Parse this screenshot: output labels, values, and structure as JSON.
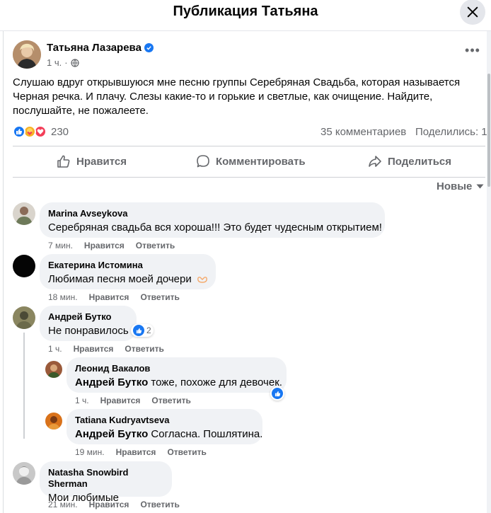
{
  "dialog": {
    "title": "Публикация Татьяна"
  },
  "post": {
    "author": "Татьяна Лазарева",
    "time": "1 ч.",
    "privacy_icon": "globe-icon",
    "text": "Слушаю вдруг открывшуюся мне песню группы Серебряная Свадьба, которая называется Черная речка. И плачу. Слезы какие-то и горькие и светлые, как очищение. Найдите, послушайте, не пожалеете.",
    "reactions_count": "230",
    "reaction_icons": [
      "like-icon",
      "care-icon",
      "love-icon"
    ],
    "comments_count": "35 комментариев",
    "shares_count": "Поделились: 1"
  },
  "actions": {
    "like": "Нравится",
    "comment": "Комментировать",
    "share": "Поделиться"
  },
  "sort": {
    "label": "Новые"
  },
  "comments": [
    {
      "name": "Marina Avseykova",
      "text": "Серебряная свадьба вся хороша!!! Это будет чудесным открытием!",
      "time": "7 мин.",
      "like": "Нравится",
      "reply": "Ответить"
    },
    {
      "name": "Екатерина Истомина",
      "text": "Любимая песня моей дочери",
      "emoji_icon": "heart-hands-icon",
      "time": "18 мин.",
      "like": "Нравится",
      "reply": "Ответить"
    },
    {
      "name": "Андрей Бутко",
      "text": "Не понравилось",
      "reactions_count": "2",
      "time": "1 ч.",
      "like": "Нравится",
      "reply": "Ответить"
    },
    {
      "name": "Natasha Snowbird Sherman",
      "text": "Мои любимые",
      "time": "21 мин.",
      "like": "Нравится",
      "reply": "Ответить"
    }
  ],
  "replies": [
    {
      "name": "Леонид Вакалов",
      "mention": "Андрей Бутко",
      "text": " тоже, похоже для девочек.",
      "time": "1 ч.",
      "like": "Нравится",
      "reply": "Ответить"
    },
    {
      "name": "Tatiana Kudryavtseva",
      "mention": "Андрей Бутко",
      "text": " Согласна. Пошлятина.",
      "time": "19 мин.",
      "like": "Нравится",
      "reply": "Ответить"
    }
  ],
  "colors": {
    "brand_blue": "#1877f2",
    "bubble": "#f0f2f5",
    "muted": "#65676b",
    "love": "#f33e58",
    "care": "#f7b125"
  }
}
